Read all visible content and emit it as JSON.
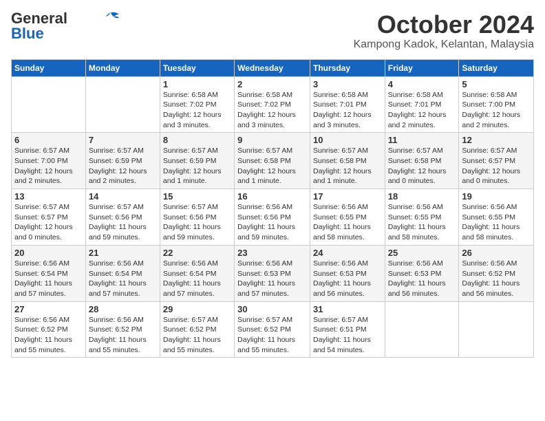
{
  "header": {
    "logo_line1": "General",
    "logo_line2": "Blue",
    "month": "October 2024",
    "location": "Kampong Kadok, Kelantan, Malaysia"
  },
  "weekdays": [
    "Sunday",
    "Monday",
    "Tuesday",
    "Wednesday",
    "Thursday",
    "Friday",
    "Saturday"
  ],
  "weeks": [
    [
      {
        "date": "",
        "info": ""
      },
      {
        "date": "",
        "info": ""
      },
      {
        "date": "1",
        "info": "Sunrise: 6:58 AM\nSunset: 7:02 PM\nDaylight: 12 hours and 3 minutes."
      },
      {
        "date": "2",
        "info": "Sunrise: 6:58 AM\nSunset: 7:02 PM\nDaylight: 12 hours and 3 minutes."
      },
      {
        "date": "3",
        "info": "Sunrise: 6:58 AM\nSunset: 7:01 PM\nDaylight: 12 hours and 3 minutes."
      },
      {
        "date": "4",
        "info": "Sunrise: 6:58 AM\nSunset: 7:01 PM\nDaylight: 12 hours and 2 minutes."
      },
      {
        "date": "5",
        "info": "Sunrise: 6:58 AM\nSunset: 7:00 PM\nDaylight: 12 hours and 2 minutes."
      }
    ],
    [
      {
        "date": "6",
        "info": "Sunrise: 6:57 AM\nSunset: 7:00 PM\nDaylight: 12 hours and 2 minutes."
      },
      {
        "date": "7",
        "info": "Sunrise: 6:57 AM\nSunset: 6:59 PM\nDaylight: 12 hours and 2 minutes."
      },
      {
        "date": "8",
        "info": "Sunrise: 6:57 AM\nSunset: 6:59 PM\nDaylight: 12 hours and 1 minute."
      },
      {
        "date": "9",
        "info": "Sunrise: 6:57 AM\nSunset: 6:58 PM\nDaylight: 12 hours and 1 minute."
      },
      {
        "date": "10",
        "info": "Sunrise: 6:57 AM\nSunset: 6:58 PM\nDaylight: 12 hours and 1 minute."
      },
      {
        "date": "11",
        "info": "Sunrise: 6:57 AM\nSunset: 6:58 PM\nDaylight: 12 hours and 0 minutes."
      },
      {
        "date": "12",
        "info": "Sunrise: 6:57 AM\nSunset: 6:57 PM\nDaylight: 12 hours and 0 minutes."
      }
    ],
    [
      {
        "date": "13",
        "info": "Sunrise: 6:57 AM\nSunset: 6:57 PM\nDaylight: 12 hours and 0 minutes."
      },
      {
        "date": "14",
        "info": "Sunrise: 6:57 AM\nSunset: 6:56 PM\nDaylight: 11 hours and 59 minutes."
      },
      {
        "date": "15",
        "info": "Sunrise: 6:57 AM\nSunset: 6:56 PM\nDaylight: 11 hours and 59 minutes."
      },
      {
        "date": "16",
        "info": "Sunrise: 6:56 AM\nSunset: 6:56 PM\nDaylight: 11 hours and 59 minutes."
      },
      {
        "date": "17",
        "info": "Sunrise: 6:56 AM\nSunset: 6:55 PM\nDaylight: 11 hours and 58 minutes."
      },
      {
        "date": "18",
        "info": "Sunrise: 6:56 AM\nSunset: 6:55 PM\nDaylight: 11 hours and 58 minutes."
      },
      {
        "date": "19",
        "info": "Sunrise: 6:56 AM\nSunset: 6:55 PM\nDaylight: 11 hours and 58 minutes."
      }
    ],
    [
      {
        "date": "20",
        "info": "Sunrise: 6:56 AM\nSunset: 6:54 PM\nDaylight: 11 hours and 57 minutes."
      },
      {
        "date": "21",
        "info": "Sunrise: 6:56 AM\nSunset: 6:54 PM\nDaylight: 11 hours and 57 minutes."
      },
      {
        "date": "22",
        "info": "Sunrise: 6:56 AM\nSunset: 6:54 PM\nDaylight: 11 hours and 57 minutes."
      },
      {
        "date": "23",
        "info": "Sunrise: 6:56 AM\nSunset: 6:53 PM\nDaylight: 11 hours and 57 minutes."
      },
      {
        "date": "24",
        "info": "Sunrise: 6:56 AM\nSunset: 6:53 PM\nDaylight: 11 hours and 56 minutes."
      },
      {
        "date": "25",
        "info": "Sunrise: 6:56 AM\nSunset: 6:53 PM\nDaylight: 11 hours and 56 minutes."
      },
      {
        "date": "26",
        "info": "Sunrise: 6:56 AM\nSunset: 6:52 PM\nDaylight: 11 hours and 56 minutes."
      }
    ],
    [
      {
        "date": "27",
        "info": "Sunrise: 6:56 AM\nSunset: 6:52 PM\nDaylight: 11 hours and 55 minutes."
      },
      {
        "date": "28",
        "info": "Sunrise: 6:56 AM\nSunset: 6:52 PM\nDaylight: 11 hours and 55 minutes."
      },
      {
        "date": "29",
        "info": "Sunrise: 6:57 AM\nSunset: 6:52 PM\nDaylight: 11 hours and 55 minutes."
      },
      {
        "date": "30",
        "info": "Sunrise: 6:57 AM\nSunset: 6:52 PM\nDaylight: 11 hours and 55 minutes."
      },
      {
        "date": "31",
        "info": "Sunrise: 6:57 AM\nSunset: 6:51 PM\nDaylight: 11 hours and 54 minutes."
      },
      {
        "date": "",
        "info": ""
      },
      {
        "date": "",
        "info": ""
      }
    ]
  ]
}
